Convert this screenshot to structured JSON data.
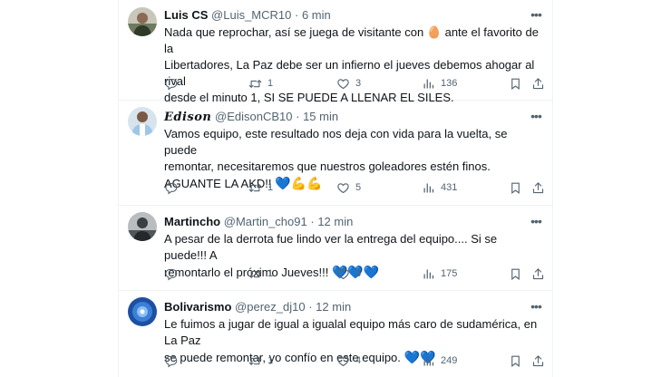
{
  "tweets": [
    {
      "name": "Luis CS",
      "handle": "@Luis_MCR10",
      "sep": "·",
      "time": "6 min",
      "text_lines": [
        "Nada que reprochar, así se juega de visitante con 🥚 ante el favorito de la",
        "Libertadores, La Paz debe ser un infierno el jueves debemos ahogar al rival",
        "desde el minuto 1, SI SE PUEDE A LLENAR EL SILES."
      ],
      "retweets": "1",
      "likes": "3",
      "views": "136"
    },
    {
      "name": "Edison",
      "handle": "@EdisonCB10",
      "sep": "·",
      "time": "15 min",
      "text_lines": [
        "Vamos equipo, este resultado nos deja con vida para la vuelta, se puede",
        "remontar, necesitaremos que nuestros goleadores estén finos.",
        "AGUANTE LA AKD!!"
      ],
      "emoji_tail": "💙💪💪",
      "retweets": "1",
      "likes": "5",
      "views": "431"
    },
    {
      "name": "Martincho",
      "handle": "@Martin_cho91",
      "sep": "·",
      "time": "12 min",
      "text_lines": [
        "A pesar de la derrota fue lindo ver la entrega del equipo.... Si se puede!!! A",
        "remontarlo el próximo Jueves!!!"
      ],
      "emoji_tail": "💙💙💙",
      "retweets": "1",
      "likes": "3",
      "views": "175"
    },
    {
      "name": "Bolivarismo",
      "handle": "@perez_dj10",
      "sep": "·",
      "time": "12 min",
      "text_lines": [
        "Le fuimos a jugar de igual a igualal equipo más caro de sudamérica, en La Paz",
        "se puede remontar, yo confío en este equipo."
      ],
      "emoji_tail": "💙💙",
      "retweets": "1",
      "likes": "4",
      "views": "249"
    }
  ],
  "icons": {
    "reply": "reply-icon",
    "retweet": "retweet-icon",
    "like": "heart-icon",
    "views": "views-icon",
    "bookmark": "bookmark-icon",
    "share": "share-icon",
    "more": "more-icon"
  },
  "colors": {
    "text": "#0f1419",
    "secondary": "#536471",
    "divider": "#eff3f4",
    "heart_emoji": "#7ec3ef"
  }
}
